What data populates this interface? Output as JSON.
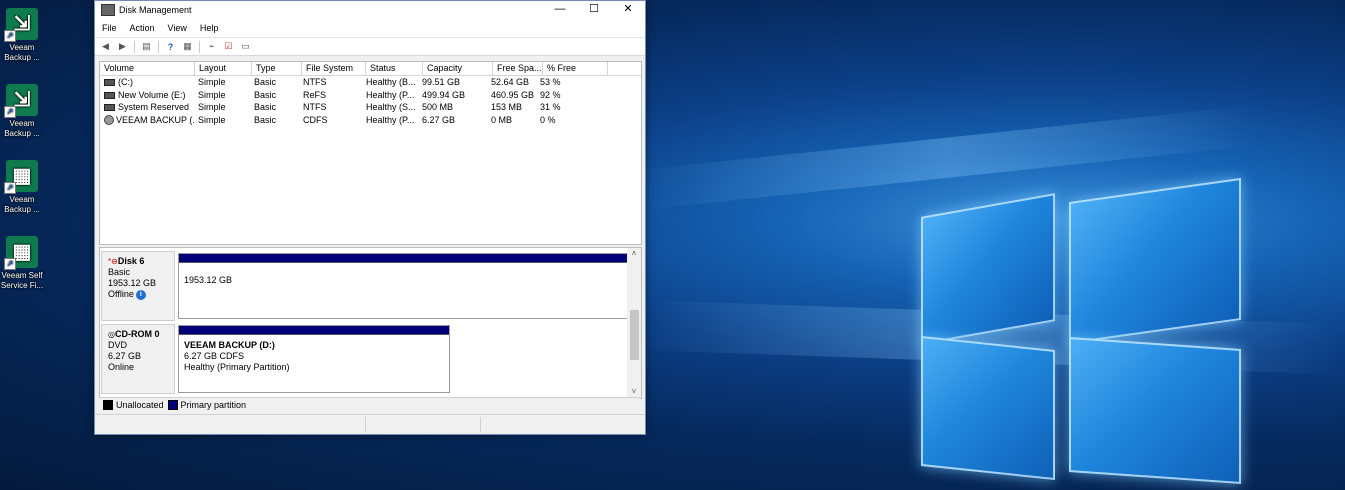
{
  "desktop": {
    "icons": [
      {
        "label": "Veeam Backup ...",
        "glyph": "veeam-backup-icon"
      },
      {
        "label": "Veeam Backup ...",
        "glyph": "veeam-backup-icon"
      },
      {
        "label": "Veeam Backup ...",
        "glyph": "veeam-backup-enterprise-icon"
      },
      {
        "label": "Veeam Self Service Fi...",
        "glyph": "veeam-self-service-icon"
      }
    ]
  },
  "window": {
    "title": "Disk Management",
    "minimize": "—",
    "maximize": "☐",
    "close": "✕"
  },
  "menu": [
    "File",
    "Action",
    "View",
    "Help"
  ],
  "toolbar": [
    "back-icon",
    "forward-icon",
    "properties-icon",
    "help-icon",
    "view-icon",
    "connect-icon",
    "check-icon",
    "settings-icon"
  ],
  "volume_list": {
    "columns": [
      "Volume",
      "Layout",
      "Type",
      "File System",
      "Status",
      "Capacity",
      "Free Spa...",
      "% Free"
    ],
    "rows": [
      {
        "volume": "(C:)",
        "layout": "Simple",
        "type": "Basic",
        "fs": "NTFS",
        "status": "Healthy (B...",
        "capacity": "99.51 GB",
        "free": "52.64 GB",
        "pct": "53 %",
        "icon": "drive"
      },
      {
        "volume": "New Volume (E:)",
        "layout": "Simple",
        "type": "Basic",
        "fs": "ReFS",
        "status": "Healthy (P...",
        "capacity": "499.94 GB",
        "free": "460.95 GB",
        "pct": "92 %",
        "icon": "drive"
      },
      {
        "volume": "System Reserved",
        "layout": "Simple",
        "type": "Basic",
        "fs": "NTFS",
        "status": "Healthy (S...",
        "capacity": "500 MB",
        "free": "153 MB",
        "pct": "31 %",
        "icon": "drive"
      },
      {
        "volume": "VEEAM BACKUP (...",
        "layout": "Simple",
        "type": "Basic",
        "fs": "CDFS",
        "status": "Healthy (P...",
        "capacity": "6.27 GB",
        "free": "0 MB",
        "pct": "0 %",
        "icon": "cd"
      }
    ]
  },
  "disks": [
    {
      "name": "Disk 6",
      "kind": "Basic",
      "size": "1953.12 GB",
      "state": "Offline",
      "partition": {
        "label": "",
        "detail": "1953.12 GB",
        "status": ""
      }
    },
    {
      "name": "CD-ROM 0",
      "kind": "DVD",
      "size": "6.27 GB",
      "state": "Online",
      "partition": {
        "label": "VEEAM BACKUP  (D:)",
        "detail": "6.27 GB CDFS",
        "status": "Healthy (Primary Partition)"
      }
    }
  ],
  "legend": [
    {
      "label": "Unallocated",
      "color": "#000000"
    },
    {
      "label": "Primary partition",
      "color": "#00007a"
    }
  ],
  "scroll": {
    "up": "˄",
    "down": "˅"
  }
}
